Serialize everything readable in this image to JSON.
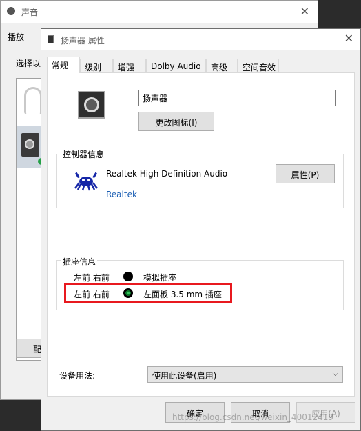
{
  "background_window": {
    "title": "声音",
    "tab": "播放",
    "select_text": "选择以",
    "button_partial": "配"
  },
  "dialog": {
    "title": "扬声器 属性",
    "tabs": [
      {
        "label": "常规",
        "active": true
      },
      {
        "label": "级别",
        "active": false
      },
      {
        "label": "增强",
        "active": false
      },
      {
        "label": "Dolby Audio",
        "active": false
      },
      {
        "label": "高级",
        "active": false
      },
      {
        "label": "空间音效",
        "active": false
      }
    ],
    "device_name": "扬声器",
    "change_icon_button": "更改图标(I)",
    "controller": {
      "group_label": "控制器信息",
      "name": "Realtek High Definition Audio",
      "vendor_link": "Realtek",
      "properties_button": "属性(P)"
    },
    "jack": {
      "group_label": "插座信息",
      "rows": [
        {
          "channels": "左前 右前",
          "color": "#000000",
          "description": "模拟插座"
        },
        {
          "channels": "左前 右前",
          "color": "#0b7a2b",
          "description": "左面板 3.5 mm 插座"
        }
      ]
    },
    "usage": {
      "label": "设备用法:",
      "selected": "使用此设备(启用)"
    },
    "buttons": {
      "ok": "确定",
      "cancel": "取消",
      "apply": "应用(A)"
    }
  },
  "annotation": {
    "highlight_color": "#e8191f"
  },
  "watermark": "https://blog.csdn.net/weixin_40012419"
}
